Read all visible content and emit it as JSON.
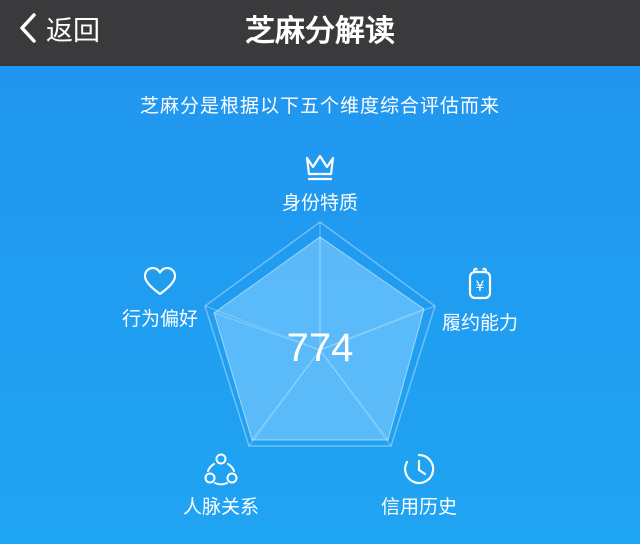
{
  "nav": {
    "back_label": "返回",
    "title": "芝麻分解读"
  },
  "subtitle": "芝麻分是根据以下五个维度综合评估而来",
  "score": "774",
  "dimensions": [
    {
      "key": "identity",
      "label": "身份特质",
      "icon": "crown-icon"
    },
    {
      "key": "ability",
      "label": "履约能力",
      "icon": "yuan-bag-icon"
    },
    {
      "key": "history",
      "label": "信用历史",
      "icon": "clock-icon"
    },
    {
      "key": "network",
      "label": "人脉关系",
      "icon": "network-icon"
    },
    {
      "key": "behavior",
      "label": "行为偏好",
      "icon": "heart-icon"
    }
  ],
  "colors": {
    "navbar": "#3A3A3C",
    "background": "#1E90EE",
    "fill": "#6FC2FF"
  }
}
